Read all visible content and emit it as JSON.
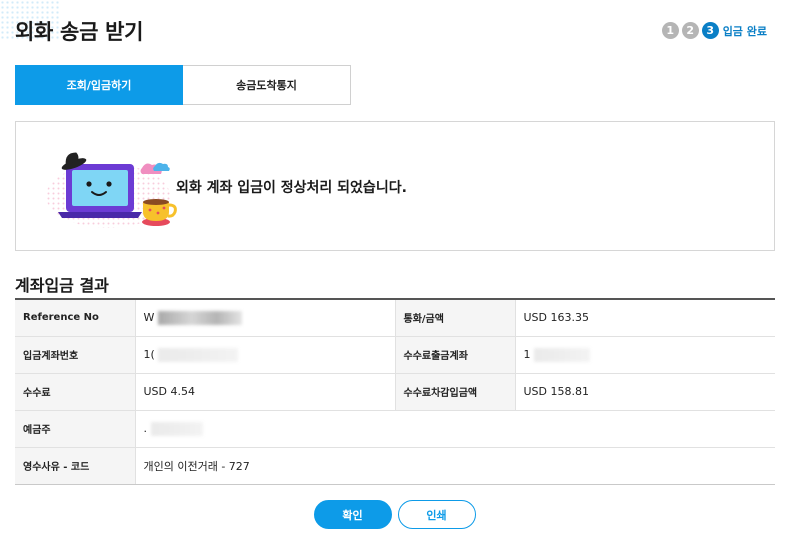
{
  "header": {
    "title": "외화 송금 받기",
    "steps": [
      "1",
      "2",
      "3"
    ],
    "current_step_label": "입금 완료"
  },
  "tabs": [
    {
      "label": "조회/입금하기",
      "active": true
    },
    {
      "label": "송금도착통지",
      "active": false
    }
  ],
  "result": {
    "message": "외화 계좌 입금이 정상처리 되었습니다.",
    "illustration": "laptop-and-coffee-illustration"
  },
  "section": {
    "title": "계좌입금 결과"
  },
  "details": {
    "reference_no_label": "Reference No",
    "reference_no_value": "W",
    "currency_amount_label": "통화/금액",
    "currency_amount_value": "USD 163.35",
    "deposit_account_label": "입금계좌번호",
    "deposit_account_value": "1(",
    "fee_account_label": "수수료출금계좌",
    "fee_account_value": "1",
    "fee_label": "수수료",
    "fee_value": "USD 4.54",
    "net_amount_label": "수수료차감입금액",
    "net_amount_value": "USD 158.81",
    "depositor_label": "예금주",
    "depositor_value": ".",
    "reason_code_label": "영수사유 - 코드",
    "reason_code_value": "개인의 이전거래 - 727"
  },
  "buttons": {
    "confirm": "확인",
    "print": "인쇄"
  },
  "colors": {
    "accent": "#0d9be8",
    "step_active": "#0a7fc6",
    "step_inactive": "#b5b5b5"
  }
}
